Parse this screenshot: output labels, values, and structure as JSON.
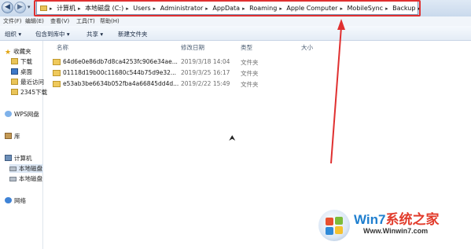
{
  "titlebar": {
    "breadcrumb": [
      "计算机",
      "本地磁盘 (C:)",
      "Users",
      "Administrator",
      "AppData",
      "Roaming",
      "Apple Computer",
      "MobileSync",
      "Backup"
    ]
  },
  "menu": {
    "file": "文件(F)",
    "edit": "编辑(E)",
    "view": "查看(V)",
    "tools": "工具(T)",
    "help": "帮助(H)"
  },
  "toolbar": {
    "organize": "组织 ▾",
    "include_library": "包含到库中 ▾",
    "share": "共享 ▾",
    "new_folder": "新建文件夹"
  },
  "sidebar": {
    "favorites": "收藏夹",
    "downloads": "下载",
    "desktop": "桌面",
    "recent": "最近访问",
    "download2345": "2345下载",
    "wps": "WPS网盘",
    "library": "库",
    "computer": "计算机",
    "drive1": "本地磁盘",
    "drive2": "本地磁盘",
    "network": "网络"
  },
  "columns": {
    "name": "名称",
    "date": "修改日期",
    "type": "类型",
    "size": "大小"
  },
  "files": [
    {
      "name": "64d6e0e86db7d8ca4253fc906e34ae...",
      "date": "2019/3/18 14:04",
      "type": "文件夹"
    },
    {
      "name": "01118d19b00c11680c544b75d9e32...",
      "date": "2019/3/25 16:17",
      "type": "文件夹"
    },
    {
      "name": "e53ab3be6634b052fba4a66845dd4d...",
      "date": "2019/2/22 15:49",
      "type": "文件夹"
    }
  ],
  "watermark": {
    "brand_a": "Win7",
    "brand_b": "系统之家",
    "url": "Www.Winwin7.com"
  },
  "colors": {
    "highlight": "#e03030",
    "folder": "#efc95b"
  }
}
